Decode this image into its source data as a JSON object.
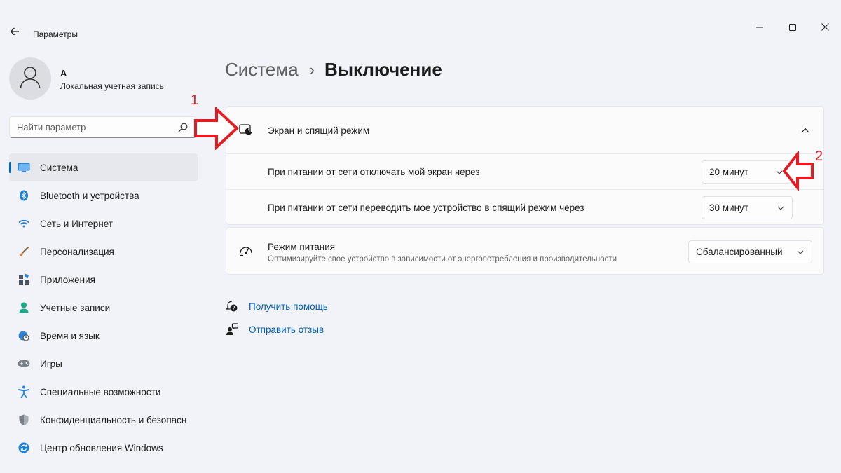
{
  "window": {
    "title": "Параметры",
    "back_icon": "back-arrow-icon",
    "controls": [
      "minimize-icon",
      "maximize-icon",
      "close-icon"
    ]
  },
  "account": {
    "name": "А",
    "type": "Локальная учетная запись",
    "avatar_icon": "user-avatar-icon"
  },
  "search": {
    "placeholder": "Найти параметр",
    "icon": "search-icon"
  },
  "sidebar": {
    "items": [
      {
        "label": "Система",
        "icon": "system-display-icon",
        "active": true
      },
      {
        "label": "Bluetooth и устройства",
        "icon": "bluetooth-icon",
        "active": false
      },
      {
        "label": "Сеть и Интернет",
        "icon": "wifi-icon",
        "active": false
      },
      {
        "label": "Персонализация",
        "icon": "brush-icon",
        "active": false
      },
      {
        "label": "Приложения",
        "icon": "apps-icon",
        "active": false
      },
      {
        "label": "Учетные записи",
        "icon": "accounts-icon",
        "active": false
      },
      {
        "label": "Время и язык",
        "icon": "globe-clock-icon",
        "active": false
      },
      {
        "label": "Игры",
        "icon": "gamepad-icon",
        "active": false
      },
      {
        "label": "Специальные возможности",
        "icon": "accessibility-icon",
        "active": false
      },
      {
        "label": "Конфиденциальность и безопасность",
        "icon": "shield-icon",
        "active": false
      },
      {
        "label": "Центр обновления Windows",
        "icon": "windows-update-icon",
        "active": false
      }
    ]
  },
  "breadcrumb": {
    "parent": "Система",
    "separator": "›",
    "current": "Выключение"
  },
  "screen_sleep": {
    "title": "Экран и спящий режим",
    "icon": "screen-sleep-icon",
    "expanded": true,
    "rows": [
      {
        "label": "При питании от сети отключать мой экран через",
        "value": "20 минут"
      },
      {
        "label": "При питании от сети переводить мое устройство в спящий режим через",
        "value": "30 минут"
      }
    ]
  },
  "power_mode": {
    "title": "Режим питания",
    "description": "Оптимизируйте свое устройство в зависимости от энергопотребления и производительности",
    "value": "Сбалансированный",
    "icon": "power-mode-gauge-icon"
  },
  "links": [
    {
      "label": "Получить помощь",
      "icon": "help-icon"
    },
    {
      "label": "Отправить отзыв",
      "icon": "feedback-icon"
    }
  ],
  "annotations": [
    {
      "number": "1",
      "color": "#e31b23"
    },
    {
      "number": "2",
      "color": "#e31b23"
    }
  ],
  "colors": {
    "accent": "#0067c0",
    "link": "#005fb8",
    "annotation_red": "#e31b23"
  }
}
